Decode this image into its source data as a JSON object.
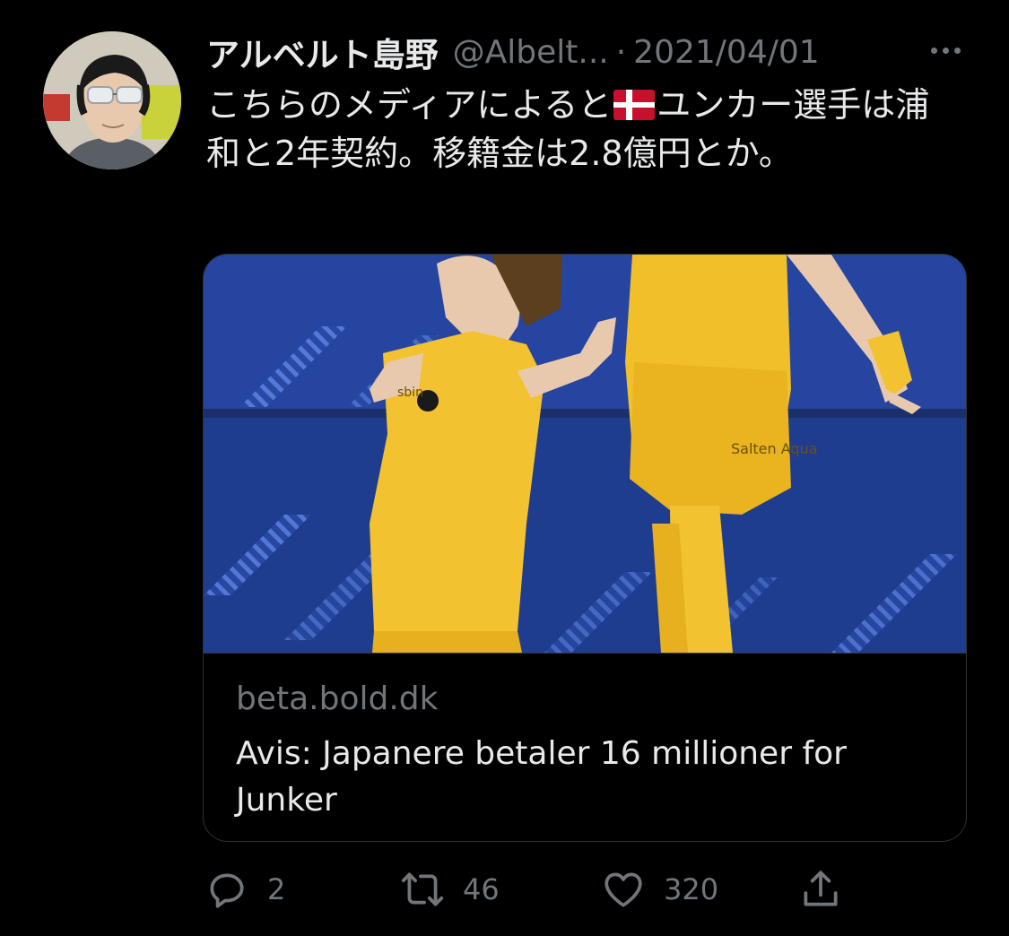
{
  "tweet": {
    "author": {
      "display_name": "アルベルト島野",
      "handle": "@Albelt...",
      "avatar_icon": "user-avatar"
    },
    "separator": "·",
    "date": "2021/04/01",
    "more_icon": "more-horizontal-icon",
    "text": {
      "part1": "こちらのメディアによると",
      "flag": "🇩🇰",
      "part2": "ユンカー選手は浦和と2年契約。移籍金は2.8億円とか。"
    },
    "card": {
      "image_icon": "football-player-photo",
      "domain": "beta.bold.dk",
      "title": "Avis: Japanere betaler 16 millioner for Junker"
    },
    "actions": {
      "reply": {
        "icon": "reply-icon",
        "count": "2"
      },
      "retweet": {
        "icon": "retweet-icon",
        "count": "46"
      },
      "like": {
        "icon": "heart-icon",
        "count": "320"
      },
      "share": {
        "icon": "share-icon"
      }
    }
  },
  "colors": {
    "background": "#000000",
    "text_primary": "#e7e9ea",
    "text_secondary": "#71767b",
    "border": "#2f3336",
    "denmark_red": "#c8102e",
    "jersey_yellow": "#f2c230",
    "stadium_blue": "#233f8f"
  }
}
